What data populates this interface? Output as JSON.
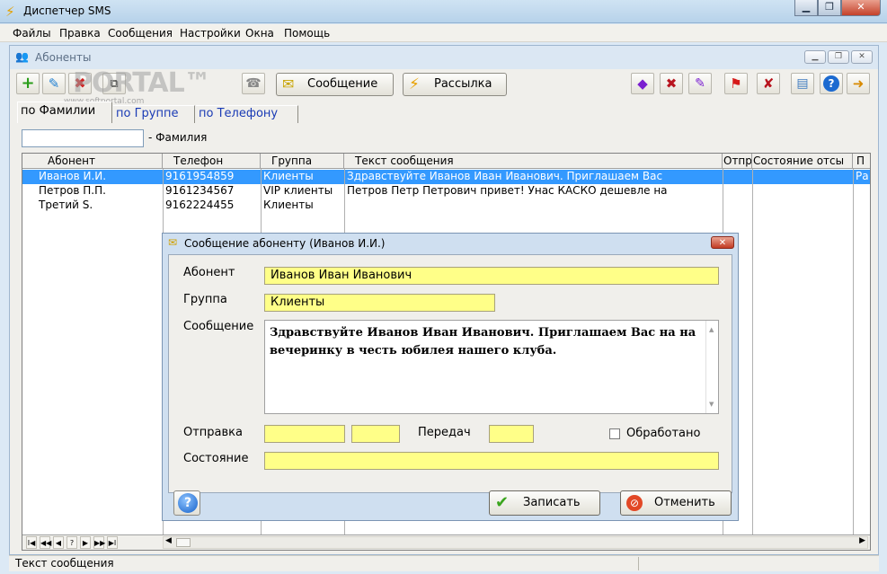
{
  "app": {
    "title": "Диспетчер SMS"
  },
  "menu": [
    "Файлы",
    "Правка",
    "Сообщения",
    "Настройки",
    "Окна",
    "Помощь"
  ],
  "mdi": {
    "title": "Абоненты",
    "watermark": "PORTAL™",
    "watermark_sub": "www.softportal.com",
    "toolbar": {
      "message_label": "Сообщение",
      "broadcast_label": "Рассылка"
    }
  },
  "tabs": [
    "по Фамилии",
    "по Группе",
    "по Телефону"
  ],
  "filter": {
    "label": "- Фамилия",
    "value": ""
  },
  "grid": {
    "columns": [
      "Абонент",
      "Телефон",
      "Группа",
      "Текст сообщения",
      "Отпр",
      "Состояние отсы",
      "П"
    ],
    "rows": [
      {
        "name": "Иванов И.И.",
        "phone": "9161954859",
        "group": "Клиенты",
        "text": "Здравствуйте Иванов Иван Иванович.  Приглашаем Вас",
        "sent": "",
        "state": "",
        "extra": "Ра"
      },
      {
        "name": "Петров П.П.",
        "phone": "9161234567",
        "group": "VIP клиенты",
        "text": "Петров Петр Петрович привет! Унас КАСКО дешевле на",
        "sent": "",
        "state": "",
        "extra": ""
      },
      {
        "name": "Третий S.",
        "phone": "9162224455",
        "group": "Клиенты",
        "text": "",
        "sent": "",
        "state": "",
        "extra": ""
      }
    ]
  },
  "nav": [
    "I◀",
    "◀◀",
    "◀",
    "?",
    "▶",
    "▶▶",
    "▶I"
  ],
  "status": {
    "text": "Текст сообщения"
  },
  "dialog": {
    "title": "Сообщение абоненту  (Иванов И.И.)",
    "labels": {
      "subscriber": "Абонент",
      "group": "Группа",
      "message": "Сообщение",
      "sending": "Отправка",
      "transfer": "Передач",
      "state": "Состояние",
      "processed": "Обработано"
    },
    "values": {
      "subscriber": "Иванов Иван Иванович",
      "group": "Клиенты",
      "message": "Здравствуйте Иванов Иван Иванович.  Приглашаем Вас на на вечеринку в честь юбилея нашего клуба.",
      "sending_date": "",
      "sending_time": "",
      "transfer": "",
      "state": ""
    },
    "processed_checked": false,
    "buttons": {
      "save": "Записать",
      "cancel": "Отменить"
    }
  },
  "colors": {
    "field_yellow": "#ffff88",
    "selection": "#3399ff",
    "link_blue": "#1a3bb5"
  }
}
